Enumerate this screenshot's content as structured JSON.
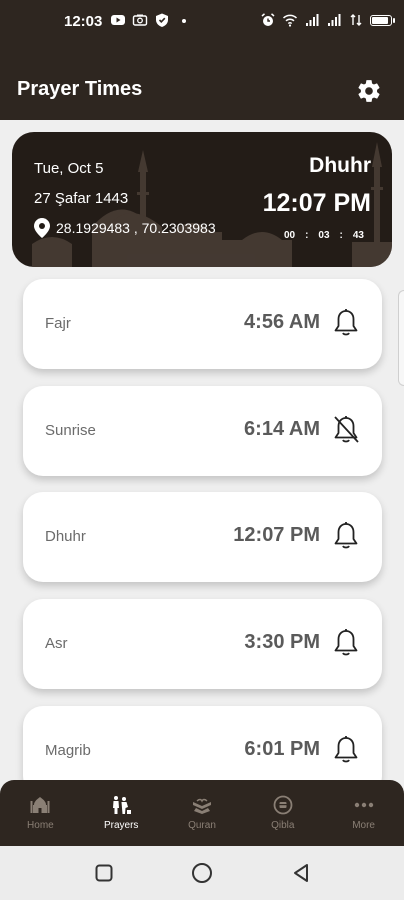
{
  "status_bar": {
    "time": "12:03",
    "left_icons": [
      "youtube-icon",
      "camera-icon",
      "shield-icon",
      "dot-icon"
    ],
    "right_icons": [
      "alarm-icon",
      "wifi-icon",
      "signal-icon",
      "signal-icon",
      "data-icon",
      "battery-icon"
    ],
    "battery": "85"
  },
  "app_bar": {
    "title": "Prayer Times",
    "settings_icon": "gear-icon"
  },
  "current": {
    "date": "Tue, Oct 5",
    "hijri_date": "27 Şafar 1443",
    "location": "28.1929483 , 70.2303983",
    "prayer_name": "Dhuhr",
    "prayer_time": "12:07 PM",
    "countdown": {
      "h": "00",
      "sep1": ":",
      "m": "03",
      "sep2": ":",
      "s": "43"
    }
  },
  "prayers": [
    {
      "name": "Fajr",
      "time": "4:56 AM",
      "bell": "bell-icon"
    },
    {
      "name": "Sunrise",
      "time": "6:14 AM",
      "bell": "bell-off-icon"
    },
    {
      "name": "Dhuhr",
      "time": "12:07 PM",
      "bell": "bell-icon"
    },
    {
      "name": "Asr",
      "time": "3:30 PM",
      "bell": "bell-icon"
    },
    {
      "name": "Magrib",
      "time": "6:01 PM",
      "bell": "bell-icon"
    }
  ],
  "nav": [
    {
      "label": "Home",
      "icon": "mosque-icon"
    },
    {
      "label": "Prayers",
      "icon": "prayers-icon",
      "active": true
    },
    {
      "label": "Quran",
      "icon": "quran-icon"
    },
    {
      "label": "Qibla",
      "icon": "compass-icon"
    },
    {
      "label": "More",
      "icon": "more-icon"
    }
  ],
  "colors": {
    "primary_dark": "#2e2620",
    "hero_bg": "#231c17",
    "page_bg": "#efefef",
    "card_bg": "#ffffff",
    "muted_text": "#6b6b6b",
    "inactive_nav": "#8a7f75"
  }
}
